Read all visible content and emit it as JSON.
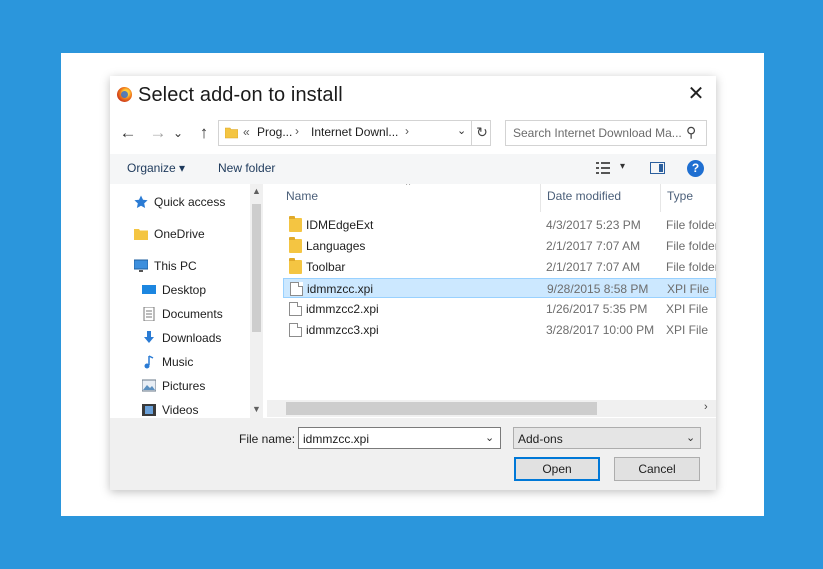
{
  "dialog": {
    "title": "Select add-on to install",
    "close_glyph": "✕"
  },
  "nav": {
    "back_glyph": "←",
    "forward_glyph": "→",
    "recent_glyph": "⌄",
    "up_glyph": "↑",
    "breadcrumb": [
      "«",
      "Prog...",
      "Internet Downl..."
    ],
    "breadcrumb_sep": "›",
    "refresh_glyph": "↻",
    "search_placeholder": "Search Internet Download Ma...",
    "search_glyph": "⚲"
  },
  "commandbar": {
    "organize": "Organize ▾",
    "new_folder": "New folder",
    "view_dropdown_glyph": "▾",
    "help_glyph": "?"
  },
  "navpane": {
    "items": [
      {
        "label": "Quick access",
        "icon": "star-icon"
      },
      {
        "label": "OneDrive",
        "icon": "folder-icon"
      },
      {
        "label": "This PC",
        "icon": "computer-icon"
      },
      {
        "label": "Desktop",
        "icon": "desktop-icon"
      },
      {
        "label": "Documents",
        "icon": "documents-icon"
      },
      {
        "label": "Downloads",
        "icon": "downloads-icon"
      },
      {
        "label": "Music",
        "icon": "music-icon"
      },
      {
        "label": "Pictures",
        "icon": "pictures-icon"
      },
      {
        "label": "Videos",
        "icon": "videos-icon"
      }
    ]
  },
  "files": {
    "columns": {
      "name": "Name",
      "date": "Date modified",
      "type": "Type"
    },
    "rows": [
      {
        "name": "IDMEdgeExt",
        "date": "4/3/2017 5:23 PM",
        "type": "File folder",
        "kind": "folder"
      },
      {
        "name": "Languages",
        "date": "2/1/2017 7:07 AM",
        "type": "File folder",
        "kind": "folder"
      },
      {
        "name": "Toolbar",
        "date": "2/1/2017 7:07 AM",
        "type": "File folder",
        "kind": "folder"
      },
      {
        "name": "idmmzcc.xpi",
        "date": "9/28/2015 8:58 PM",
        "type": "XPI File",
        "kind": "file",
        "selected": true
      },
      {
        "name": "idmmzcc2.xpi",
        "date": "1/26/2017 5:35 PM",
        "type": "XPI File",
        "kind": "file"
      },
      {
        "name": "idmmzcc3.xpi",
        "date": "3/28/2017 10:00 PM",
        "type": "XPI File",
        "kind": "file"
      }
    ]
  },
  "footer": {
    "file_name_label": "File name:",
    "file_name_value": "idmmzcc.xpi",
    "file_type_value": "Add-ons",
    "open_label": "Open",
    "cancel_label": "Cancel"
  },
  "colors": {
    "accent": "#0078d7",
    "selection": "#cce8ff",
    "backdrop": "#2b96dc"
  }
}
